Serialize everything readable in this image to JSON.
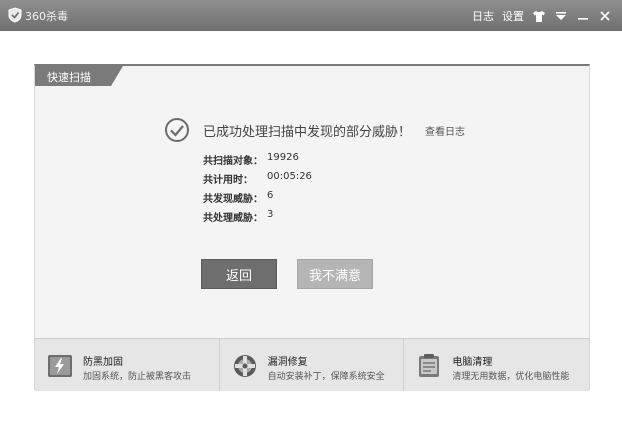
{
  "titlebar": {
    "app_name": "360杀毒",
    "log_label": "日志",
    "settings_label": "设置"
  },
  "panel": {
    "tab_label": "快速扫描",
    "result_message": "已成功处理扫描中发现的部分威胁！",
    "view_log_link": "查看日志",
    "stats": [
      {
        "label": "共扫描对象：",
        "value": "19926"
      },
      {
        "label": "共计用时：",
        "value": "00:05:26"
      },
      {
        "label": "共发现威胁：",
        "value": "6"
      },
      {
        "label": "共处理威胁：",
        "value": "3"
      }
    ],
    "buttons": {
      "back": "返回",
      "unsatisfied": "我不满意"
    }
  },
  "bottom_cards": [
    {
      "title": "防黑加固",
      "desc": "加固系统，防止被黑客攻击",
      "icon": "shield-lightning-icon"
    },
    {
      "title": "漏洞修复",
      "desc": "自动安装补丁，保障系统安全",
      "icon": "patch-icon"
    },
    {
      "title": "电脑清理",
      "desc": "清理无用数据，优化电脑性能",
      "icon": "cleanup-icon"
    }
  ],
  "colors": {
    "titlebar": "#7f7f7f",
    "back_button": "#6e6e6e",
    "unsatisfied_button": "#b5b5b5"
  }
}
